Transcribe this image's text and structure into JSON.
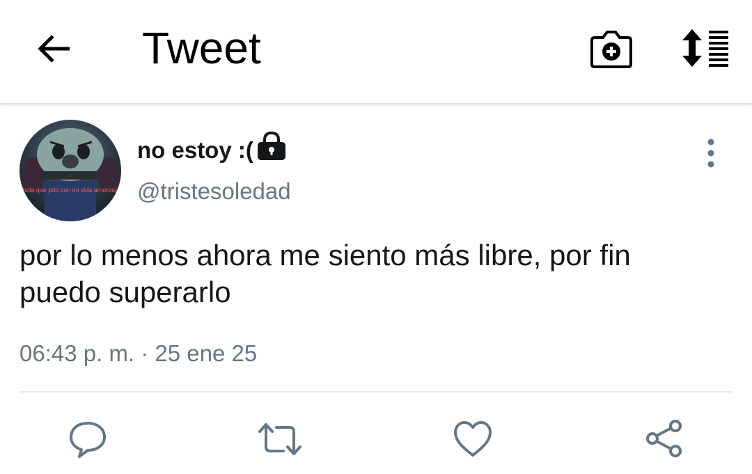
{
  "header": {
    "title": "Tweet",
    "back_icon": "arrow-left-icon",
    "camera_icon": "camera-plus-icon",
    "sort_icon": "sort-list-icon"
  },
  "tweet": {
    "author_name": "no estoy :(",
    "protected_icon": "lock-icon",
    "handle": "@tristesoledad",
    "avatar_caption": "hola que pdo con mi vida amorosa",
    "text": "por lo menos ahora me siento más libre, por fin puedo superarlo",
    "timestamp": "06:43 p. m. · 25 ene 25",
    "more_icon": "more-vertical-icon"
  },
  "actions": [
    {
      "name": "reply",
      "icon": "reply-icon"
    },
    {
      "name": "retweet",
      "icon": "retweet-icon"
    },
    {
      "name": "like",
      "icon": "heart-icon"
    },
    {
      "name": "share",
      "icon": "share-icon"
    }
  ],
  "colors": {
    "text_primary": "#14171a",
    "text_secondary": "#657786",
    "icon_action": "#657786",
    "divider": "#e1e8ed",
    "background": "#ffffff"
  }
}
